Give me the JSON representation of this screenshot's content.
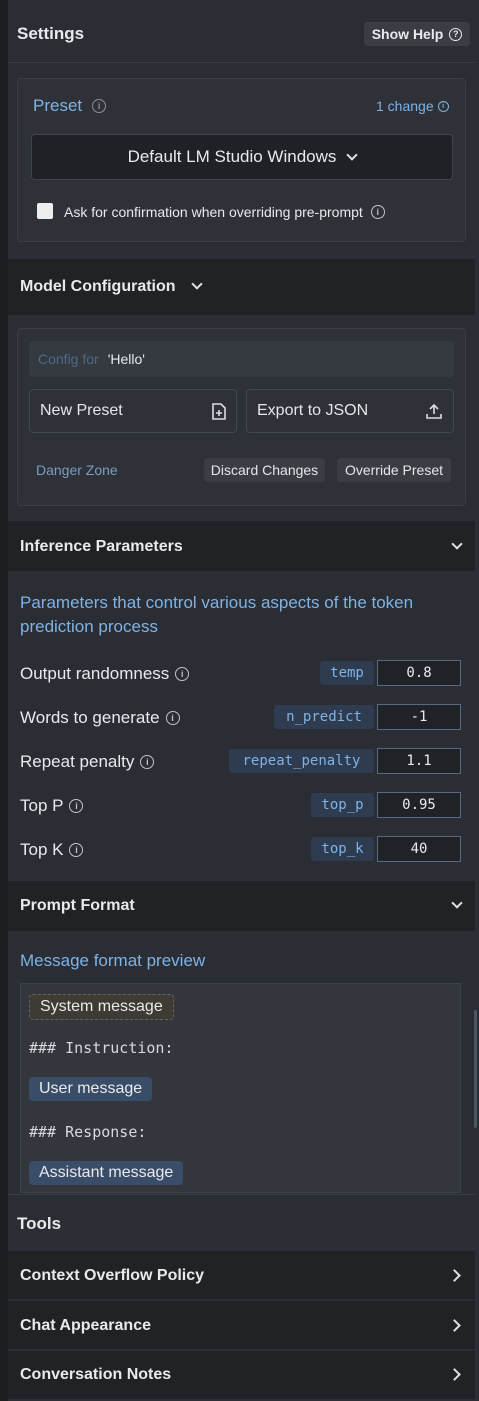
{
  "settings": {
    "title": "Settings",
    "show_help": "Show Help"
  },
  "preset": {
    "label": "Preset",
    "changes": "1 change",
    "selected": "Default LM Studio Windows",
    "confirm_label": "Ask for confirmation when overriding pre-prompt"
  },
  "model_config": {
    "title": "Model Configuration",
    "config_for_label": "Config for",
    "config_for_value": "'Hello'",
    "new_preset": "New Preset",
    "export_json": "Export to JSON",
    "danger_zone": "Danger Zone",
    "discard": "Discard Changes",
    "override": "Override Preset"
  },
  "inference": {
    "title": "Inference Parameters",
    "description": "Parameters that control various aspects of the token prediction process",
    "params": [
      {
        "label": "Output randomness",
        "key": "temp",
        "value": "0.8"
      },
      {
        "label": "Words to generate",
        "key": "n_predict",
        "value": "-1"
      },
      {
        "label": "Repeat penalty",
        "key": "repeat_penalty",
        "value": "1.1"
      },
      {
        "label": "Top P",
        "key": "top_p",
        "value": "0.95"
      },
      {
        "label": "Top K",
        "key": "top_k",
        "value": "40"
      }
    ]
  },
  "prompt_format": {
    "title": "Prompt Format",
    "preview_label": "Message format preview",
    "system_message": "System message",
    "instruction": "### Instruction:",
    "user_message": "User message",
    "response": "### Response:",
    "assistant_message": "Assistant message"
  },
  "tools": {
    "title": "Tools",
    "items": [
      "Context Overflow Policy",
      "Chat Appearance",
      "Conversation Notes"
    ]
  }
}
